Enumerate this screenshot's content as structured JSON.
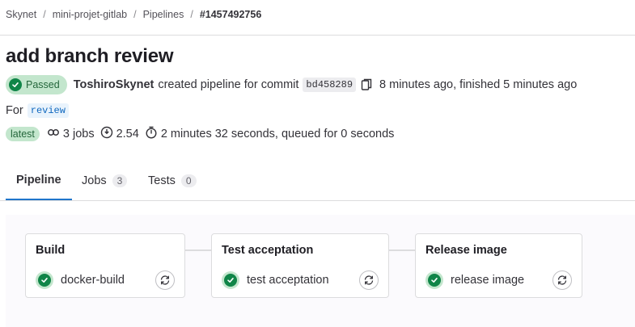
{
  "breadcrumb": {
    "items": [
      "Skynet",
      "mini-projet-gitlab",
      "Pipelines"
    ],
    "current": "#1457492756",
    "separator": "/"
  },
  "title": "add branch review",
  "status": {
    "label": "Passed",
    "color": "#108548"
  },
  "creator": {
    "user": "ToshiroSkynet",
    "text": "created pipeline for commit",
    "commit": "bd458289",
    "timing": "8 minutes ago, finished 5 minutes ago"
  },
  "ref": {
    "prefix": "For",
    "branch": "review"
  },
  "summary": {
    "latest": "latest",
    "jobs": "3 jobs",
    "compute": "2.54",
    "duration": "2 minutes 32 seconds, queued for 0 seconds"
  },
  "tabs": [
    {
      "label": "Pipeline",
      "active": true
    },
    {
      "label": "Jobs",
      "count": "3"
    },
    {
      "label": "Tests",
      "count": "0"
    }
  ],
  "stages": [
    {
      "title": "Build",
      "job": "docker-build",
      "status": "success-icon"
    },
    {
      "title": "Test acceptation",
      "job": "test acceptation",
      "status": "success-icon"
    },
    {
      "title": "Release image",
      "job": "release image",
      "status": "success-icon"
    }
  ],
  "icons": {
    "copy": "copy-icon",
    "jobs": "pipeline-link-icon",
    "compute": "info-clock-icon",
    "duration": "stopwatch-icon",
    "retry": "retry-icon"
  },
  "colors": {
    "accent": "#1f75cb",
    "success": "#108548",
    "success_bg": "#c3e6cd"
  }
}
